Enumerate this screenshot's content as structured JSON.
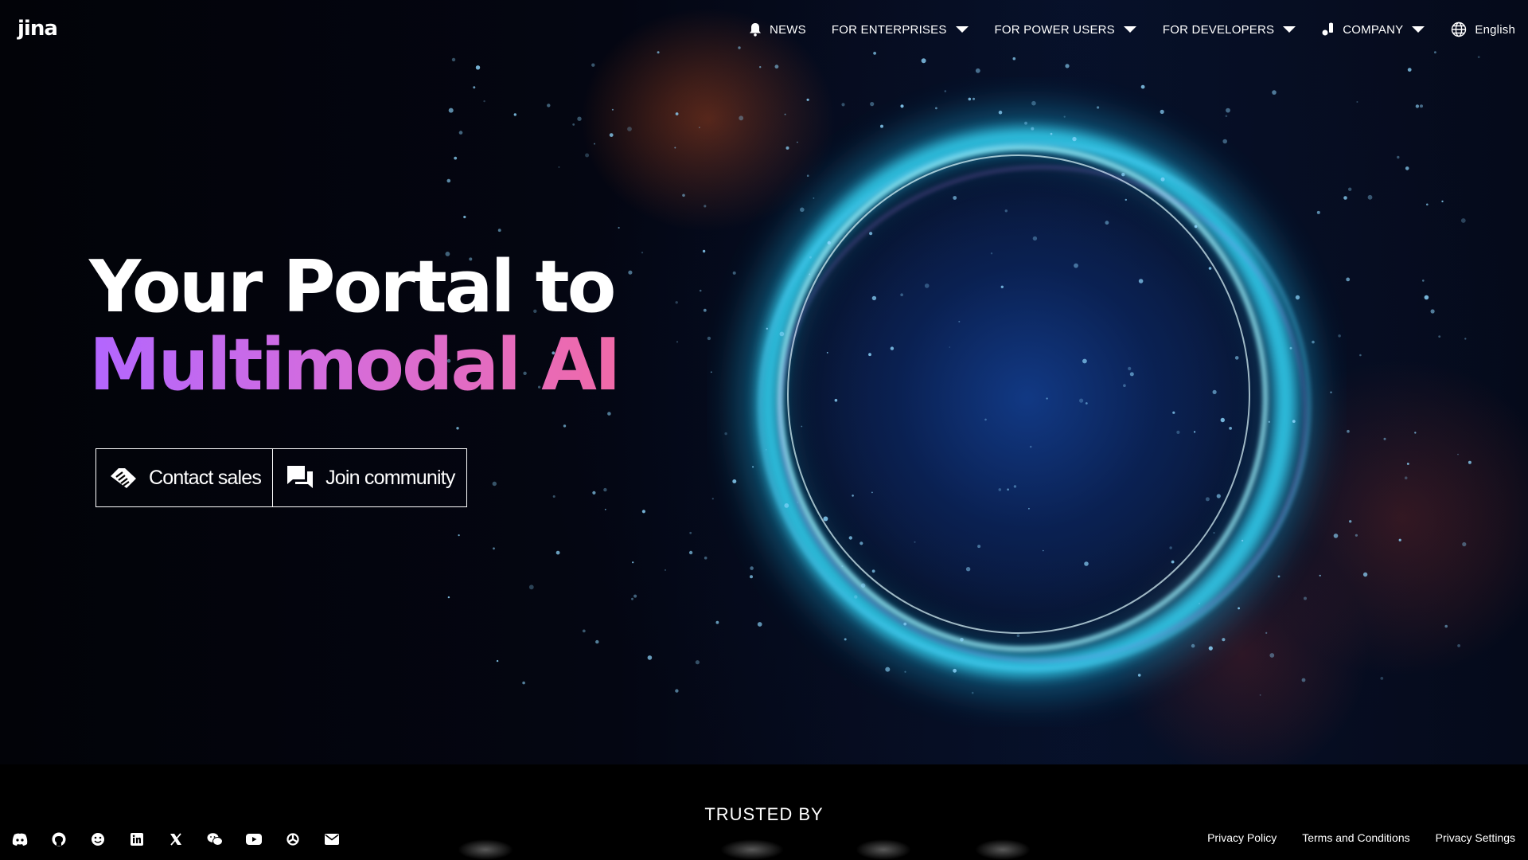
{
  "brand": {
    "logo_text": "jina"
  },
  "nav": {
    "items": [
      {
        "label": "NEWS",
        "icon": "bell-icon",
        "has_dropdown": false
      },
      {
        "label": "FOR ENTERPRISES",
        "has_dropdown": true
      },
      {
        "label": "FOR POWER USERS",
        "has_dropdown": true
      },
      {
        "label": "FOR DEVELOPERS",
        "has_dropdown": true
      },
      {
        "label": "COMPANY",
        "icon": "company-icon",
        "has_dropdown": true
      }
    ],
    "language": {
      "label": "English",
      "icon": "globe-icon"
    }
  },
  "hero": {
    "line1": "Your Portal to",
    "line2": "Multimodal AI",
    "gradient_colors": [
      "#b266ff",
      "#f06aa8"
    ],
    "buttons": [
      {
        "label": "Contact sales",
        "icon": "handshake-icon"
      },
      {
        "label": "Join community",
        "icon": "chat-icon"
      }
    ]
  },
  "trusted": {
    "title": "TRUSTED BY"
  },
  "footer": {
    "social_icons": [
      "discord-icon",
      "github-icon",
      "huggingface-icon",
      "linkedin-icon",
      "x-icon",
      "wechat-icon",
      "youtube-icon",
      "openai-icon",
      "email-icon"
    ],
    "links": [
      "Privacy Policy",
      "Terms and Conditions",
      "Privacy Settings"
    ]
  }
}
